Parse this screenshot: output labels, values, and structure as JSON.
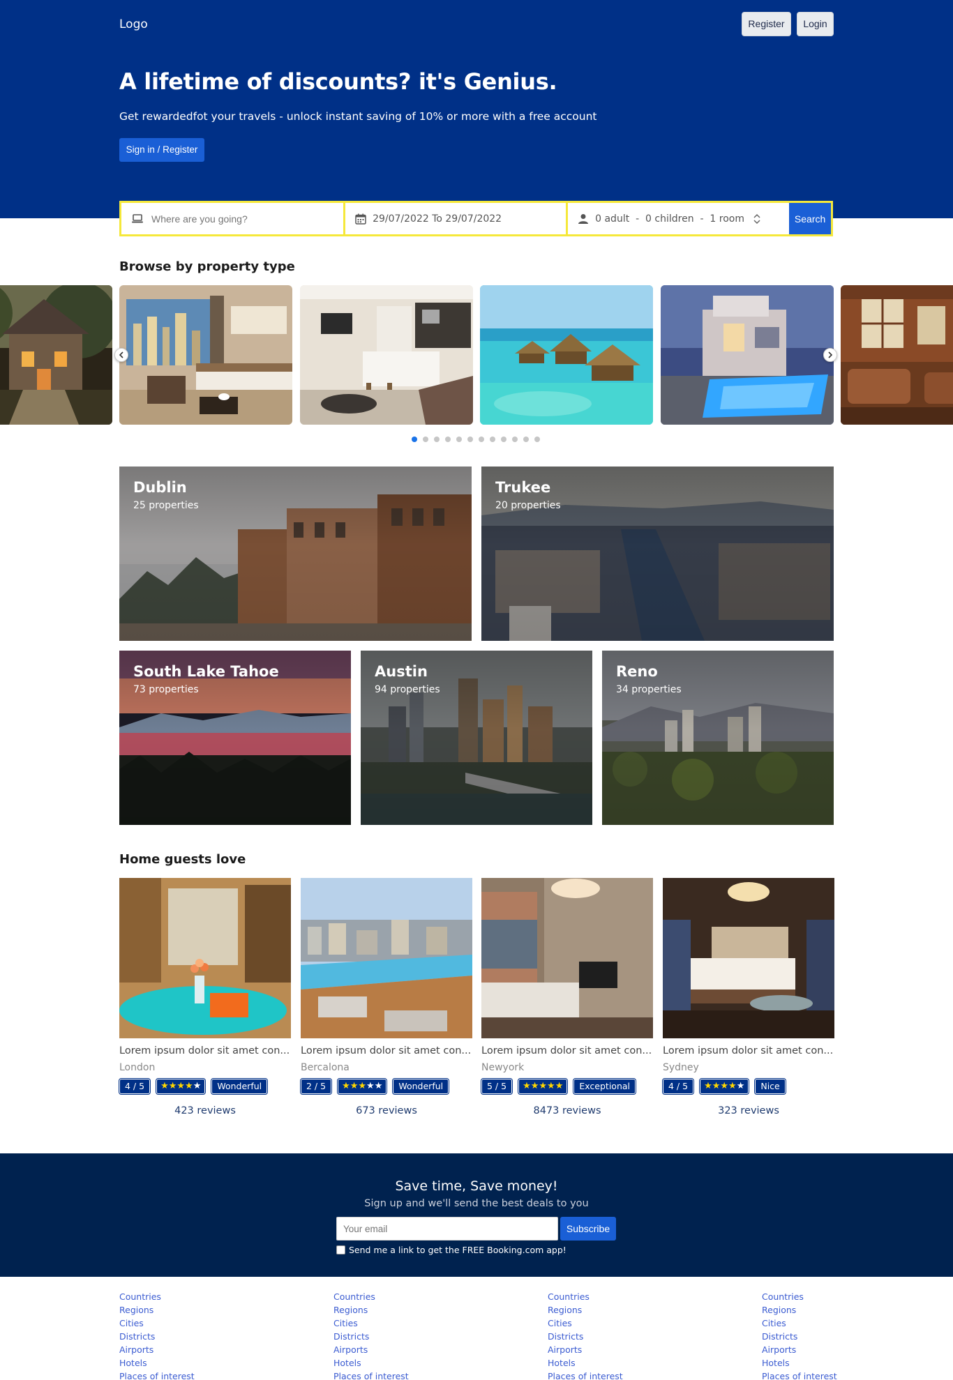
{
  "header": {
    "logo": "Logo",
    "register_label": "Register",
    "login_label": "Login",
    "title": "A lifetime of discounts? it's Genius.",
    "subtitle": "Get rewardedfot your travels - unlock instant saving of 10% or more with a free account",
    "cta_label": "Sign in / Register"
  },
  "search": {
    "destination_placeholder": "Where are you going?",
    "dates": "29/07/2022 To 29/07/2022",
    "guests": "0 adult  -  0 children  -  1 room",
    "button_label": "Search"
  },
  "property_types": {
    "title": "Browse by property type",
    "slides": [
      "slide-1",
      "slide-2",
      "slide-3",
      "slide-4",
      "slide-5",
      "slide-6"
    ],
    "dot_count": 12,
    "active_dot": 0
  },
  "cities": [
    {
      "name": "Dublin",
      "count": "25 properties"
    },
    {
      "name": "Trukee",
      "count": "20 properties"
    },
    {
      "name": "South Lake Tahoe",
      "count": "73 properties"
    },
    {
      "name": "Austin",
      "count": "94 properties"
    },
    {
      "name": "Reno",
      "count": "34 properties"
    }
  ],
  "homes": {
    "title": "Home guests love",
    "items": [
      {
        "title": "Lorem ipsum dolor sit amet con...",
        "city": "London",
        "score": "4 / 5",
        "rating_stars": 5,
        "label": "Wonderful",
        "reviews": "423 reviews"
      },
      {
        "title": "Lorem ipsum dolor sit amet con...",
        "city": "Bercalona",
        "score": "2 / 5",
        "rating_stars": 5,
        "label": "Wonderful",
        "reviews": "673 reviews"
      },
      {
        "title": "Lorem ipsum dolor sit amet con...",
        "city": "Newyork",
        "score": "5 / 5",
        "rating_stars": 5,
        "label": "Exceptional",
        "reviews": "8473 reviews"
      },
      {
        "title": "Lorem ipsum dolor sit amet con...",
        "city": "Sydney",
        "score": "4 / 5",
        "rating_stars": 5,
        "label": "Nice",
        "reviews": "323 reviews"
      }
    ]
  },
  "newsletter": {
    "title": "Save time, Save money!",
    "subtitle": "Sign up and we'll send the best deals to you",
    "email_placeholder": "Your email",
    "button_label": "Subscribe",
    "checkbox_label": "Send me a link to get the FREE Booking.com app!"
  },
  "footer": {
    "columns": [
      [
        "Countries",
        "Regions",
        "Cities",
        "Districts",
        "Airports",
        "Hotels",
        "Places of interest"
      ],
      [
        "Countries",
        "Regions",
        "Cities",
        "Districts",
        "Airports",
        "Hotels",
        "Places of interest"
      ],
      [
        "Countries",
        "Regions",
        "Cities",
        "Districts",
        "Airports",
        "Hotels",
        "Places of interest"
      ],
      [
        "Countries",
        "Regions",
        "Cities",
        "Districts",
        "Airports",
        "Hotels",
        "Places of interest"
      ]
    ]
  },
  "colors": {
    "brand": "#003087",
    "accent": "#1a5fd6",
    "search_border": "#f5e83a",
    "newsletter_bg": "#00224f"
  }
}
